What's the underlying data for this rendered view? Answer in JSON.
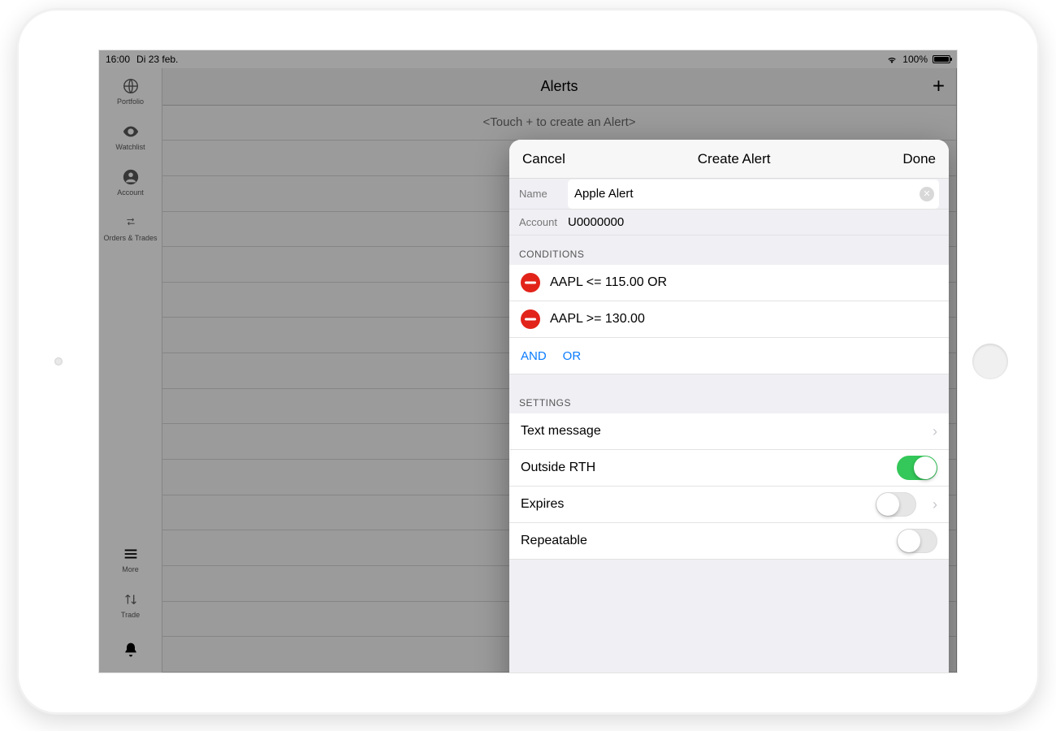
{
  "statusbar": {
    "time": "16:00",
    "date": "Di 23 feb.",
    "battery_pct": "100%"
  },
  "sidebar": {
    "items": [
      {
        "label": "Portfolio"
      },
      {
        "label": "Watchlist"
      },
      {
        "label": "Account"
      },
      {
        "label": "Orders & Trades"
      }
    ],
    "bottom": [
      {
        "label": "More"
      },
      {
        "label": "Trade"
      },
      {
        "label": ""
      }
    ]
  },
  "list": {
    "title": "Alerts",
    "empty_hint": "<Touch + to create an Alert>"
  },
  "popover": {
    "cancel": "Cancel",
    "title": "Create Alert",
    "done": "Done",
    "name_label": "Name",
    "name_value": "Apple Alert",
    "account_label": "Account",
    "account_value": "U0000000",
    "conditions_header": "CONDITIONS",
    "conditions": [
      "AAPL <= 115.00 OR",
      "AAPL >= 130.00"
    ],
    "logic": {
      "and": "AND",
      "or": "OR"
    },
    "settings_header": "SETTINGS",
    "settings": {
      "text_message": "Text message",
      "outside_rth": "Outside RTH",
      "expires": "Expires",
      "repeatable": "Repeatable",
      "outside_rth_on": true,
      "expires_on": false,
      "repeatable_on": false
    }
  }
}
